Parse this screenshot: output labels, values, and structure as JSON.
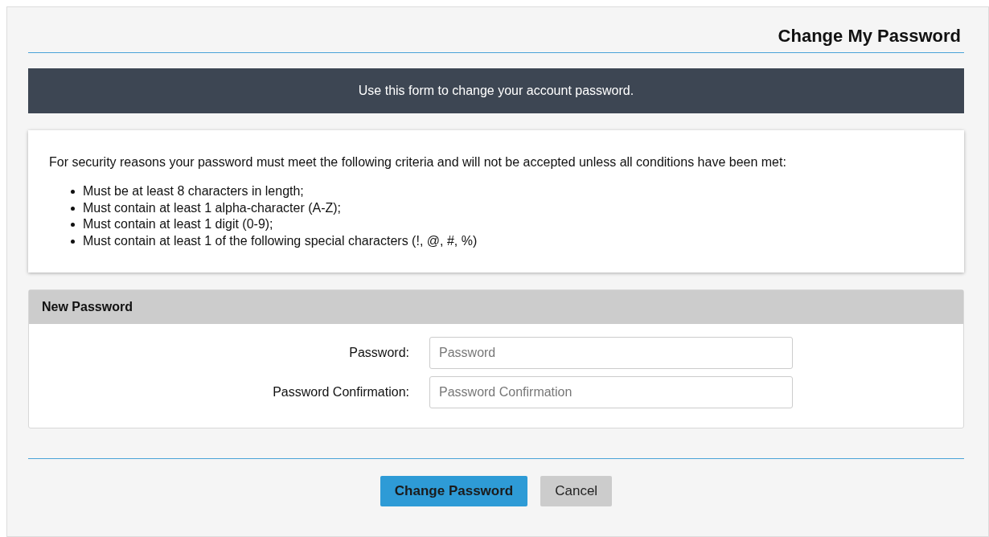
{
  "page_title": "Change My Password",
  "banner": "Use this form to change your account password.",
  "criteria": {
    "intro": "For security reasons your password must meet the following criteria and will not be accepted unless all conditions have been met:",
    "items": [
      "Must be at least 8 characters in length;",
      "Must contain at least 1 alpha-character (A-Z);",
      "Must contain at least 1 digit (0-9);",
      "Must contain at least 1 of the following special characters (!, @, #, %)"
    ]
  },
  "panel": {
    "title": "New Password",
    "fields": [
      {
        "label": "Password:",
        "placeholder": "Password"
      },
      {
        "label": "Password Confirmation:",
        "placeholder": "Password Confirmation"
      }
    ]
  },
  "buttons": [
    {
      "label": "Change Password",
      "kind": "primary"
    },
    {
      "label": "Cancel",
      "kind": "secondary"
    }
  ]
}
